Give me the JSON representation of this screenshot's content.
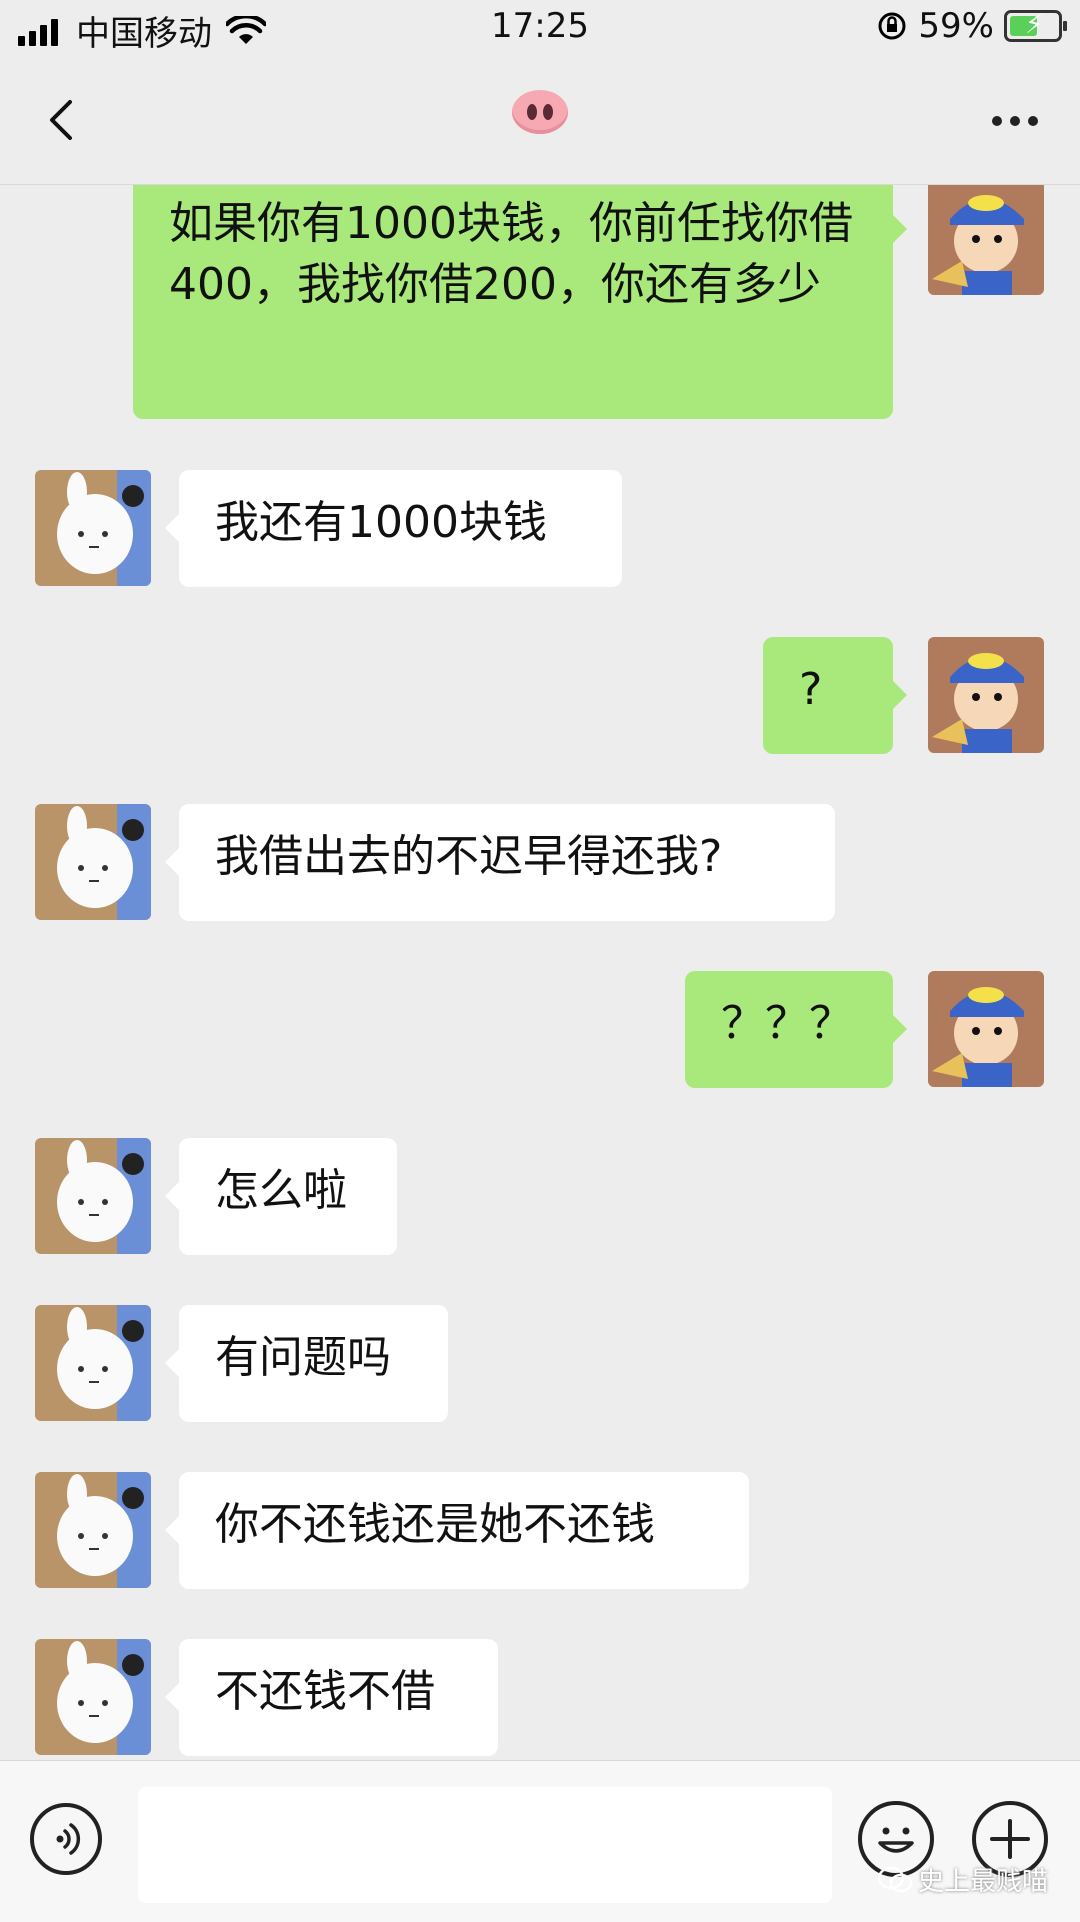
{
  "status_bar": {
    "carrier": "中国移动",
    "time": "17:25",
    "battery_percent": "59%",
    "battery_level": 0.59,
    "icons": [
      "signal-icon",
      "wifi-icon",
      "orientation-lock-icon",
      "battery-charging-icon"
    ]
  },
  "nav": {
    "title_emoji": "pig-nose-emoji",
    "icons": [
      "back-chevron-icon",
      "more-dots-icon"
    ]
  },
  "messages": [
    {
      "side": "out",
      "text": "如果你有1000块钱，你前任找你借400，我找你借200，你还有多少"
    },
    {
      "side": "in",
      "text": "我还有1000块钱"
    },
    {
      "side": "out",
      "text": "?"
    },
    {
      "side": "in",
      "text": "我借出去的不迟早得还我?"
    },
    {
      "side": "out",
      "text": "？？？"
    },
    {
      "side": "in",
      "text": "怎么啦"
    },
    {
      "side": "in",
      "text": "有问题吗"
    },
    {
      "side": "in",
      "text": "你不还钱还是她不还钱"
    },
    {
      "side": "in",
      "text": "不还钱不借"
    }
  ],
  "input_bar": {
    "text_value": "",
    "icons": [
      "voice-icon",
      "emoji-icon",
      "plus-icon"
    ]
  },
  "watermark": {
    "text": "史上最贱喵"
  },
  "colors": {
    "background": "#ededed",
    "outgoing_bubble": "#a9e87a",
    "incoming_bubble": "#ffffff",
    "battery_fill": "#5ad05a"
  }
}
